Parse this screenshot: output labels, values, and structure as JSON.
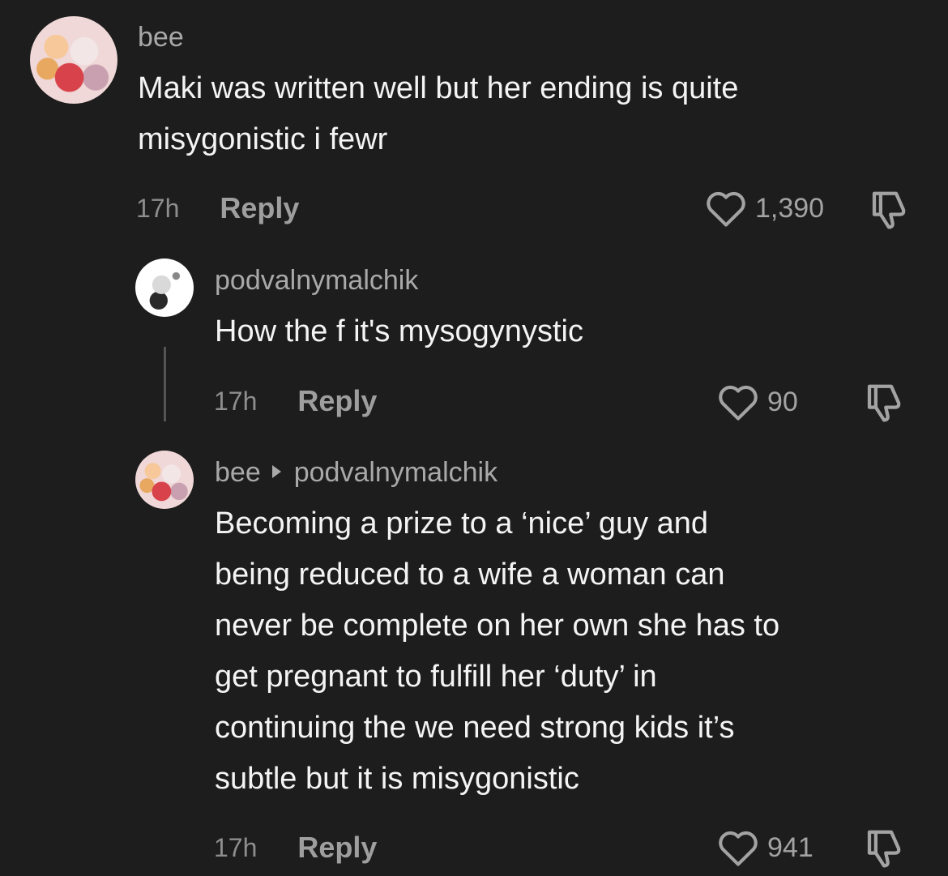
{
  "comments": [
    {
      "username": "bee",
      "text_lines": [
        "Maki was written well but her ending is quite",
        "misygonistic i fewr"
      ],
      "time": "17h",
      "reply_label": "Reply",
      "likes": "1,390"
    },
    {
      "username": "podvalnymalchik",
      "text_lines": [
        "How the f it's mysogynystic"
      ],
      "time": "17h",
      "reply_label": "Reply",
      "likes": "90"
    },
    {
      "username": "bee",
      "reply_to": "podvalnymalchik",
      "text_lines": [
        "Becoming a prize to a ‘nice’ guy and",
        "being reduced to a wife a woman can",
        "never be complete on her own she has to",
        "get pregnant to fulfill her ‘duty’ in",
        "continuing the we need strong kids it’s",
        "subtle but it is misygonistic"
      ],
      "time": "17h",
      "reply_label": "Reply",
      "likes": "941"
    }
  ],
  "icons": {
    "like": "heart-icon",
    "dislike": "thumbs-down-icon"
  }
}
